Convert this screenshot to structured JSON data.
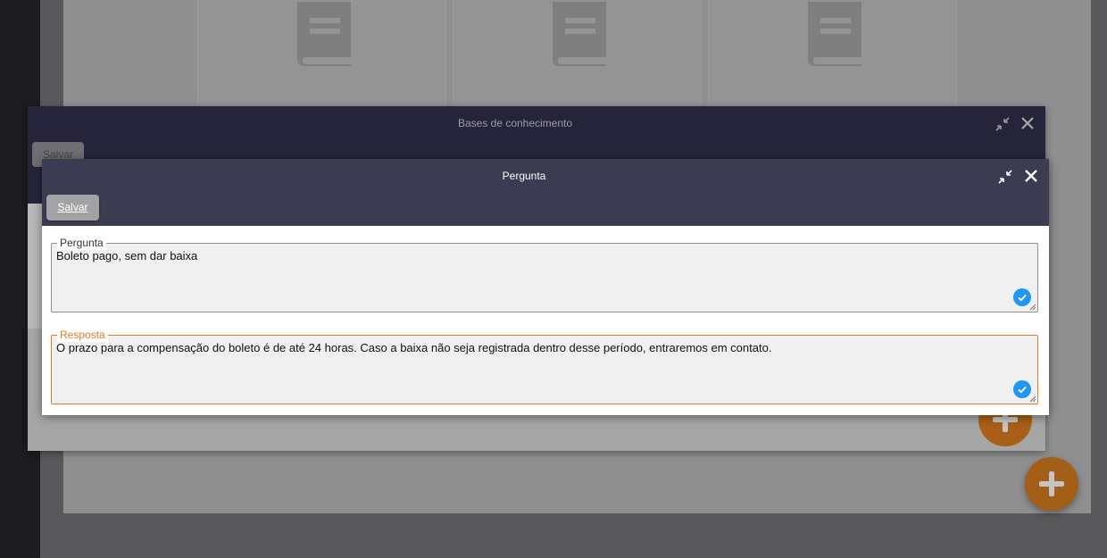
{
  "outer_dialog": {
    "title": "Bases de conhecimento",
    "save_label": "Salvar"
  },
  "inner_dialog": {
    "title": "Pergunta",
    "save_label": "Salvar",
    "fields": {
      "pergunta": {
        "label": "Pergunta",
        "value": "Boleto pago, sem dar baixa"
      },
      "resposta": {
        "label": "Resposta",
        "value": "O prazo para a compensação do boleto é de até 24 horas. Caso a baixa não seja registrada dentro desse período, entraremos em contato."
      }
    }
  },
  "colors": {
    "accent": "#e07b22",
    "check": "#2196f3",
    "header_dark": "#3b3b51"
  },
  "icons": [
    "book-icon",
    "minimize-icon",
    "close-icon",
    "check-icon",
    "add-icon",
    "resize-grip-icon"
  ]
}
